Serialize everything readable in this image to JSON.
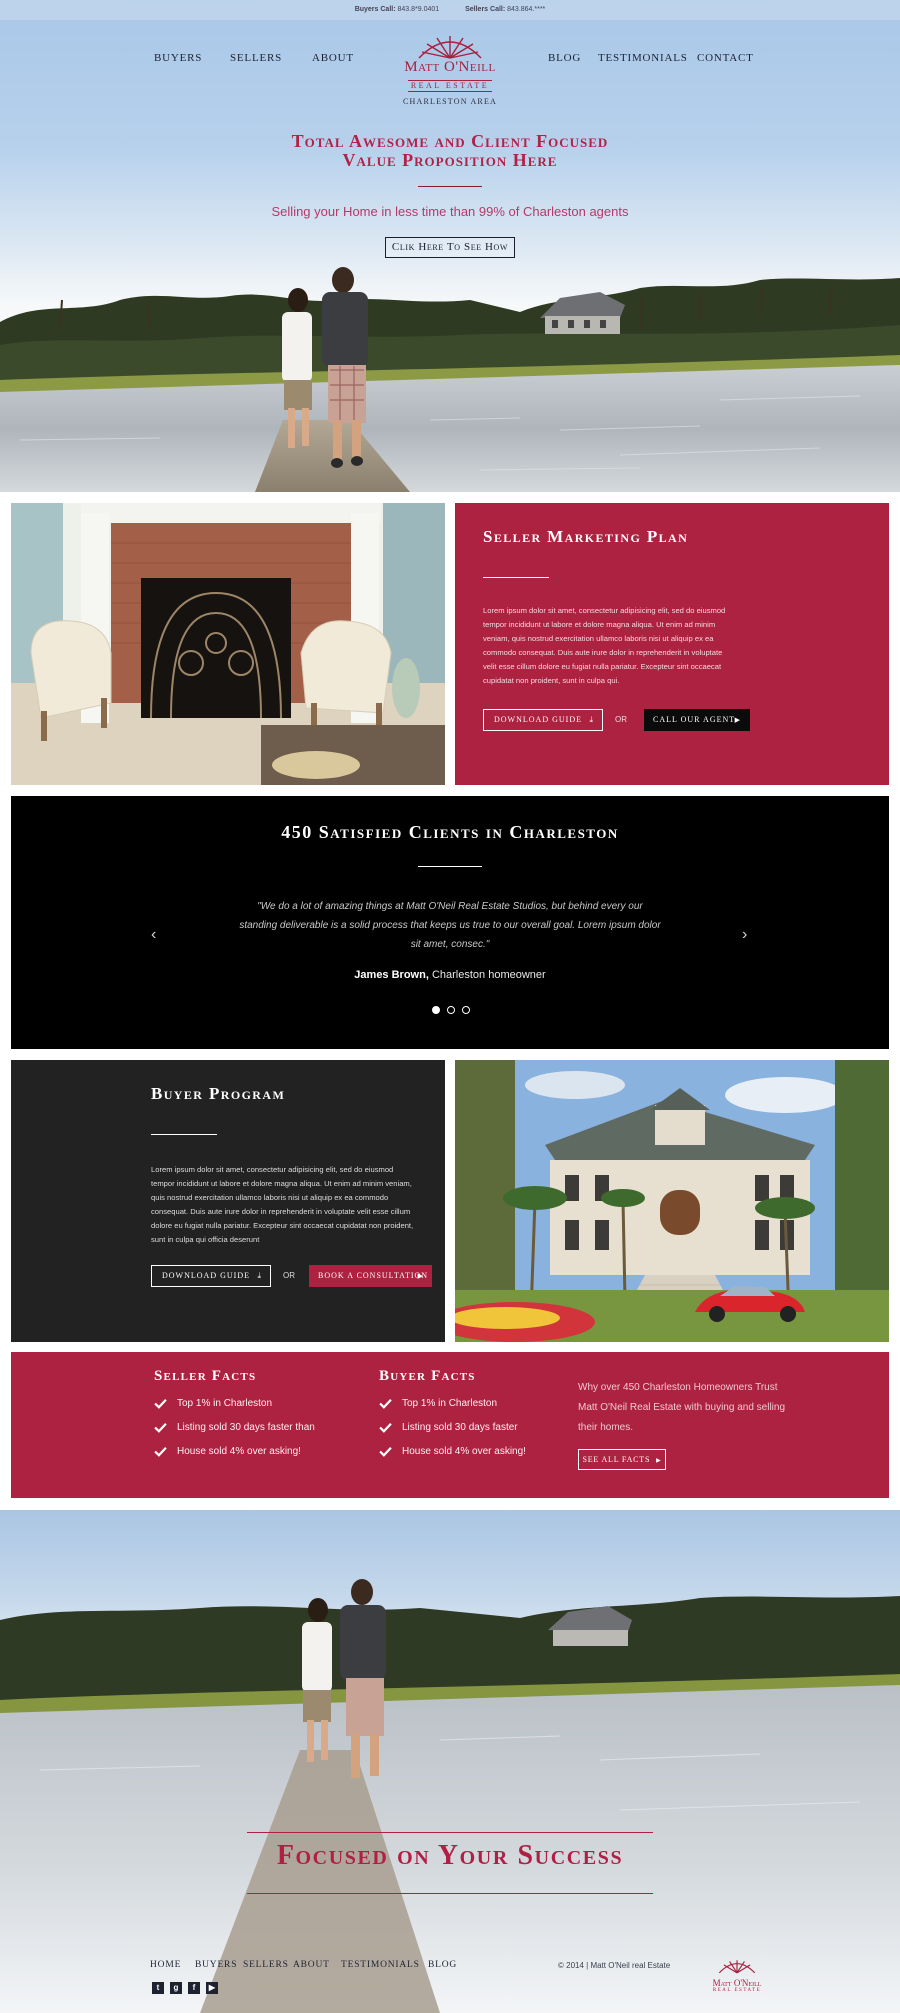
{
  "topbar": {
    "buyers_label": "Buyers Call:",
    "buyers_phone": "843.8*9.0401",
    "sellers_label": "Sellers Call:",
    "sellers_phone": "843.864.****"
  },
  "nav": {
    "left": [
      "Buyers",
      "Sellers",
      "About"
    ],
    "right": [
      "Blog",
      "Testimonials",
      "Contact"
    ]
  },
  "logo": {
    "name": "Matt O'Neill",
    "sub": "REAL ESTATE",
    "area": "Charleston Area"
  },
  "hero": {
    "title_line1": "Total Awesome and Client Focused",
    "title_line2": "Value Proposition Here",
    "subtitle": "Selling your Home in less time than 99% of Charleston agents",
    "cta": "Clik Here To See How"
  },
  "seller_plan": {
    "title": "Seller Marketing Plan",
    "body": "Lorem ipsum dolor sit amet, consectetur adipisicing elit, sed do eiusmod tempor incididunt ut labore et dolore magna aliqua. Ut enim ad minim veniam, quis nostrud exercitation ullamco laboris nisi ut aliquip ex ea commodo consequat. Duis aute irure dolor in reprehenderit in voluptate velit esse cillum dolore eu fugiat nulla pariatur. Excepteur sint occaecat cupidatat non proident, sunt in culpa qui.",
    "download_label": "Download Guide",
    "or_label": "OR",
    "call_label": "Call Our Agent"
  },
  "testimonial": {
    "title": "450 Satisfied Clients in Charleston",
    "quote": "\"We do a lot of amazing things at Matt O'Neil Real Estate Studios, but behind every our standing deliverable is a solid process that keeps us true to our overall goal. Lorem ipsum dolor sit amet, consec.\"",
    "author_name": "James Brown,",
    "author_role": "Charleston homeowner"
  },
  "buyer_program": {
    "title": "Buyer Program",
    "body": "Lorem ipsum dolor sit amet, consectetur adipisicing elit, sed do eiusmod tempor incididunt ut labore et dolore magna aliqua. Ut enim ad minim veniam, quis nostrud exercitation ullamco laboris nisi ut aliquip ex ea commodo consequat. Duis aute irure dolor in reprehenderit in voluptate velit esse cillum dolore eu fugiat nulla pariatur. Excepteur sint occaecat cupidatat non proident, sunt in culpa qui officia deserunt",
    "download_label": "Download Guide",
    "or_label": "OR",
    "consult_label": "Book a Consultation"
  },
  "facts": {
    "seller_title": "Seller Facts",
    "seller_items": [
      "Top 1% in Charleston",
      "Listing sold 30 days faster than",
      "House sold 4% over asking!"
    ],
    "buyer_title": "Buyer Facts",
    "buyer_items": [
      "Top 1% in Charleston",
      "Listing sold 30 days faster",
      "House sold 4% over asking!"
    ],
    "why_text": "Why over 450 Charleston Homeowners Trust Matt O'Neil Real Estate with buying and selling their homes.",
    "see_all_label": "See All Facts"
  },
  "bottom": {
    "title": "Focused on Your Success"
  },
  "footer": {
    "links": [
      "Home",
      "Buyers",
      "Sellers",
      "About",
      "Testimonials",
      "Blog"
    ],
    "copyright": "© 2014 | Matt O'Neil real Estate",
    "social": [
      "twitter-icon",
      "google-plus-icon",
      "facebook-icon",
      "youtube-icon"
    ]
  },
  "colors": {
    "brand_red": "#ad2240",
    "dark": "#222222",
    "black": "#000000"
  }
}
